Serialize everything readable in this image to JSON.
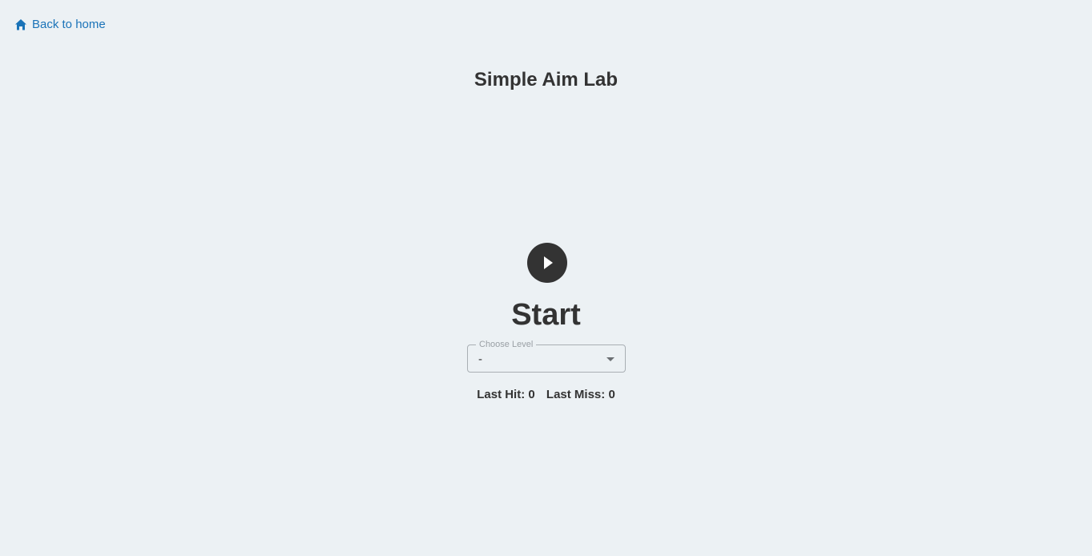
{
  "nav": {
    "back_label": "Back to home",
    "back_icon": "home-icon",
    "link_color": "#1a73b8"
  },
  "header": {
    "title": "Simple Aim Lab"
  },
  "game": {
    "play_icon": "play-icon",
    "start_label": "Start",
    "level_select": {
      "legend": "Choose Level",
      "value": "-"
    },
    "stats": {
      "last_hit_label": "Last Hit:",
      "last_hit_value": "0",
      "last_miss_label": "Last Miss:",
      "last_miss_value": "0"
    }
  },
  "colors": {
    "background": "#ecf1f4",
    "text": "#333333",
    "play_button": "#333333"
  }
}
